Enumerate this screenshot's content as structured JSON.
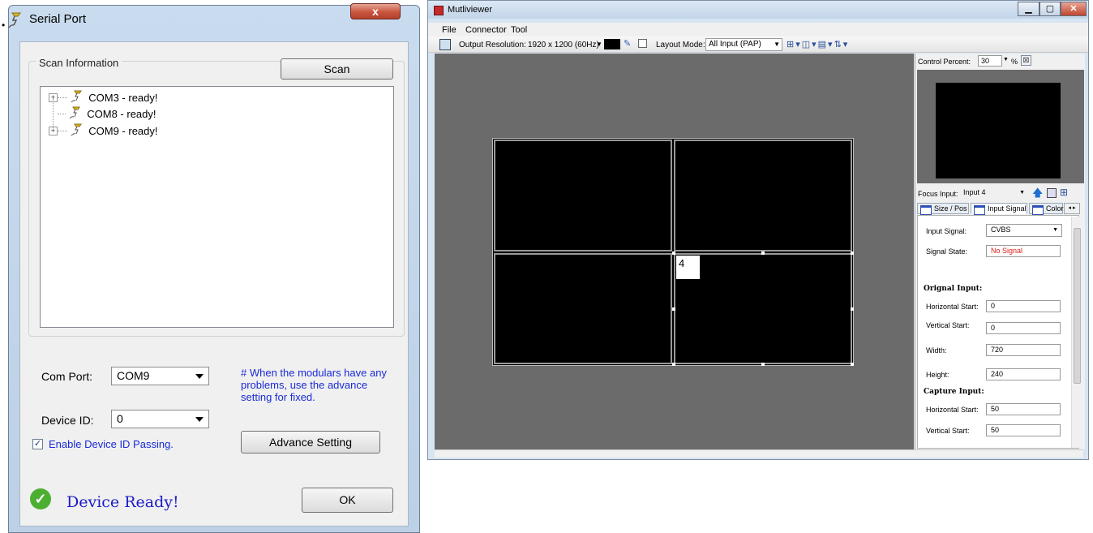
{
  "serial_port": {
    "title": "Serial Port",
    "close_glyph": "x",
    "scan_group_label": "Scan Information",
    "scan_button": "Scan",
    "tree": [
      {
        "label": "COM3 - ready!",
        "expandable": true
      },
      {
        "label": "COM8 - ready!",
        "expandable": false
      },
      {
        "label": "COM9 - ready!",
        "expandable": true
      }
    ],
    "com_port_label": "Com Port:",
    "com_port_value": "COM9",
    "device_id_label": "Device ID:",
    "device_id_value": "0",
    "hint": "# When the modulars have any problems, use the advance setting for fixed.",
    "enable_passing_label": "Enable Device ID Passing.",
    "enable_passing_checked": true,
    "advance_button": "Advance Setting",
    "status": "Device Ready!",
    "ok_button": "OK",
    "colors": {
      "hint": "#1a2ad8",
      "status": "#1a1ac8",
      "ready_icon": "#4caf32"
    }
  },
  "multiviewer": {
    "title": "Mutliviewer",
    "menu": [
      "File",
      "Connector",
      "Tool"
    ],
    "toolbar": {
      "output_resolution_label": "Output Resolution:",
      "output_resolution_value": "1920 x 1200 (60Hz)",
      "layout_mode_label": "Layout Mode:",
      "layout_mode_value": "All Input (PAP)"
    },
    "window_label": "4",
    "control_percent_label": "Control Percent:",
    "control_percent_value": "30",
    "control_percent_unit": "%",
    "focus_input_label": "Focus Input:",
    "focus_input_value": "Input 4",
    "tabs": [
      "Size / Pos",
      "Input Signal",
      "Color"
    ],
    "active_tab": "Input Signal",
    "input_signal_label": "Input Signal:",
    "input_signal_value": "CVBS",
    "signal_state_label": "Signal State:",
    "signal_state_value": "No Signal",
    "original_input_heading": "Orignal Input:",
    "original_fields": [
      {
        "label": "Horizontal Start:",
        "value": "0"
      },
      {
        "label": "Vertical Start:",
        "value": "0"
      },
      {
        "label": "Width:",
        "value": "720"
      },
      {
        "label": "Height:",
        "value": "240"
      }
    ],
    "capture_input_heading": "Capture Input:",
    "capture_fields": [
      {
        "label": "Horizontal Start:",
        "value": "50"
      },
      {
        "label": "Vertical Start:",
        "value": "50"
      }
    ],
    "colors": {
      "signal_state": "#e0201a",
      "canvas": "#6b6b6b"
    }
  }
}
